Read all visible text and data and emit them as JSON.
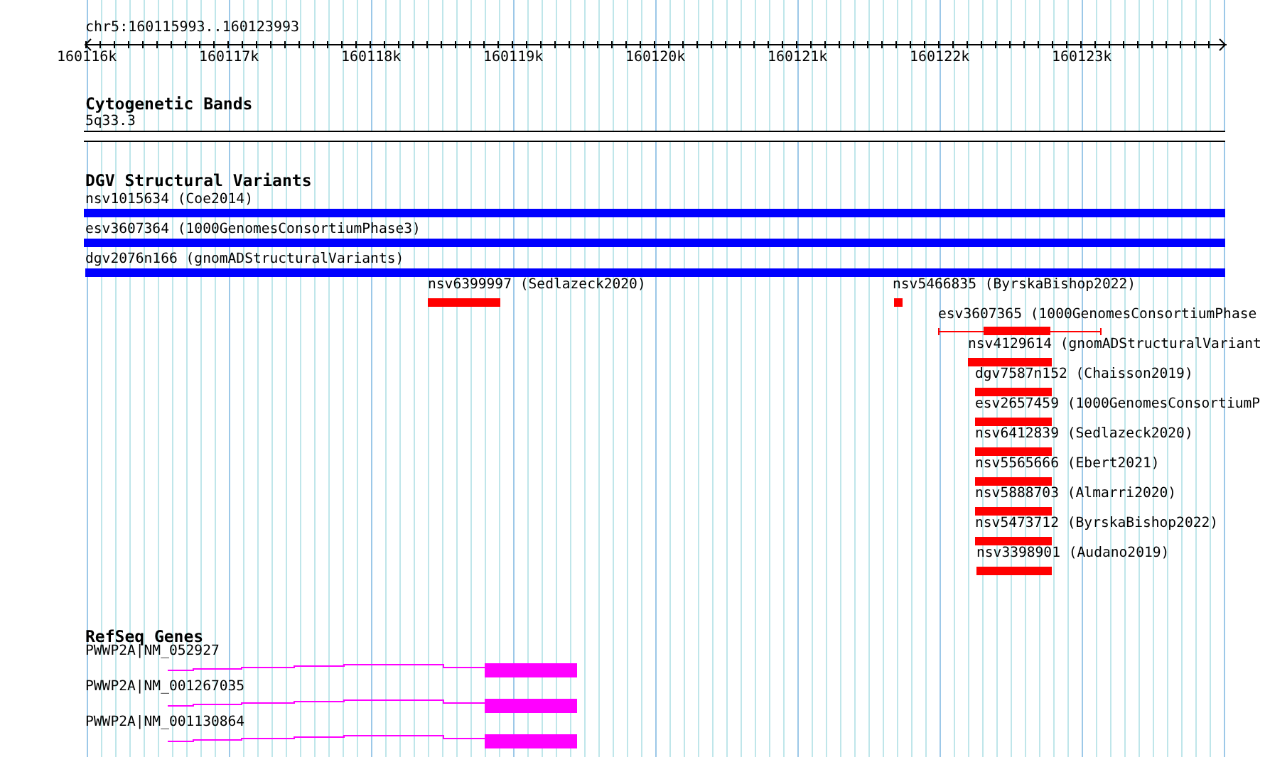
{
  "ruler": {
    "location": "chr5:160115993..160123993",
    "ticks": [
      "160116k",
      "160117k",
      "160118k",
      "160119k",
      "160120k",
      "160121k",
      "160122k",
      "160123k"
    ]
  },
  "tracks": [
    {
      "title": "Cytogenetic Bands",
      "kind": "bands",
      "features": [
        {
          "label": "5q33.3"
        }
      ]
    },
    {
      "title": "DGV Structural Variants",
      "kind": "variants",
      "features": [
        {
          "label": "nsv1015634 (Coe2014)",
          "kind": "bar",
          "color": "#0000ff"
        },
        {
          "label": "esv3607364 (1000GenomesConsortiumPhase3)",
          "kind": "bar",
          "color": "#0000ff"
        },
        {
          "label": "dgv2076n166 (gnomADStructuralVariants)",
          "kind": "bar",
          "color": "#0000ff"
        },
        {
          "label": "nsv6399997 (Sedlazeck2020)",
          "kind": "bar",
          "color": "#ff0000"
        },
        {
          "label": "nsv5466835 (ByrskaBishop2022)",
          "kind": "bar",
          "color": "#ff0000"
        },
        {
          "label": "esv3607365 (1000GenomesConsortiumPhase",
          "kind": "span",
          "color": "#ff0000"
        },
        {
          "label": "nsv4129614 (gnomADStructuralVariant",
          "kind": "bar",
          "color": "#ff0000"
        },
        {
          "label": "dgv7587n152 (Chaisson2019)",
          "kind": "bar",
          "color": "#ff0000"
        },
        {
          "label": "esv2657459 (1000GenomesConsortiumP",
          "kind": "bar",
          "color": "#ff0000"
        },
        {
          "label": "nsv6412839 (Sedlazeck2020)",
          "kind": "bar",
          "color": "#ff0000"
        },
        {
          "label": "nsv5565666 (Ebert2021)",
          "kind": "bar",
          "color": "#ff0000"
        },
        {
          "label": "nsv5888703 (Almarri2020)",
          "kind": "bar",
          "color": "#ff0000"
        },
        {
          "label": "nsv5473712 (ByrskaBishop2022)",
          "kind": "bar",
          "color": "#ff0000"
        },
        {
          "label": "nsv3398901 (Audano2019)",
          "kind": "bar",
          "color": "#ff0000"
        }
      ]
    },
    {
      "title": "RefSeq Genes",
      "kind": "genes",
      "features": [
        {
          "label": "PWWP2A|NM_052927"
        },
        {
          "label": "PWWP2A|NM_001267035"
        },
        {
          "label": "PWWP2A|NM_001130864"
        }
      ]
    }
  ]
}
